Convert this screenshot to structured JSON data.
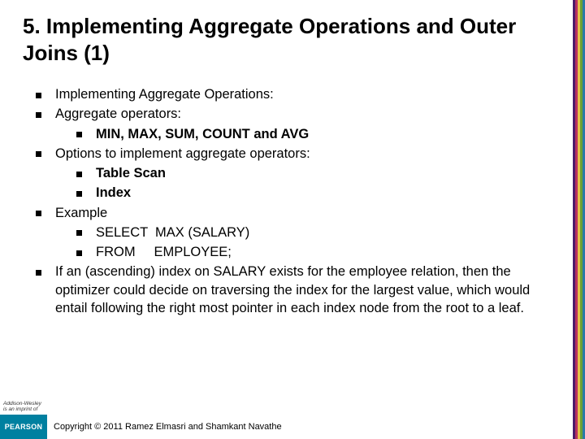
{
  "title": "5. Implementing Aggregate Operations and Outer Joins (1)",
  "bullets": {
    "b1": "Implementing Aggregate Operations:",
    "b2": "Aggregate operators:",
    "b2_1": "MIN, MAX, SUM, COUNT and AVG",
    "b3": "Options to implement aggregate operators:",
    "b3_1": "Table Scan",
    "b3_2": "Index",
    "b4": "Example",
    "b4_1": "SELECT  MAX (SALARY)",
    "b4_2": "FROM     EMPLOYEE;",
    "b5": "If an (ascending) index on SALARY exists for the employee relation, then the optimizer could decide on traversing the index for the largest value, which would entail following the right most pointer in each index node from the root to a leaf."
  },
  "footer": {
    "pearson": "PEARSON",
    "aw_line1": "Addison-Wesley",
    "aw_line2": "is an imprint of",
    "copyright": "Copyright © 2011 Ramez Elmasri and Shamkant Navathe"
  }
}
